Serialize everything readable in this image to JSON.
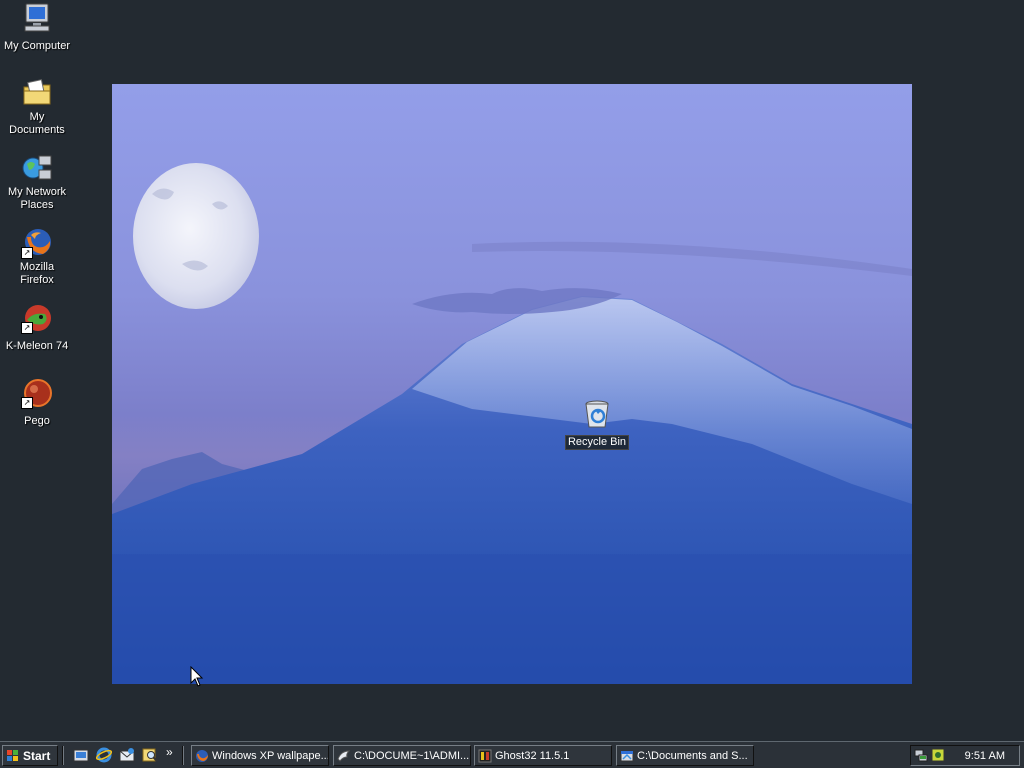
{
  "desktop_icons": [
    {
      "label": "My Computer",
      "icon": "computer-icon"
    },
    {
      "label": "My Documents",
      "icon": "folder-documents-icon"
    },
    {
      "label": "My Network Places",
      "icon": "network-places-icon"
    },
    {
      "label": "Mozilla Firefox",
      "icon": "firefox-icon"
    },
    {
      "label": "K-Meleon 74",
      "icon": "kmeleon-icon"
    },
    {
      "label": "Pego",
      "icon": "pego-icon"
    }
  ],
  "recycle_bin": {
    "label": "Recycle Bin",
    "icon": "recycle-bin-icon"
  },
  "taskbar": {
    "start_label": "Start",
    "more_label": "»",
    "quick_launch": [
      "show-desktop-icon",
      "internet-explorer-icon",
      "outlook-express-icon",
      "search-icon"
    ],
    "tasks": [
      {
        "label": "Windows XP wallpape...",
        "icon": "firefox-icon"
      },
      {
        "label": "C:\\DOCUME~1\\ADMI...",
        "icon": "bird-icon"
      },
      {
        "label": "Ghost32 11.5.1",
        "icon": "ghost-icon"
      },
      {
        "label": "C:\\Documents and S...",
        "icon": "explorer-window-icon"
      }
    ],
    "tray_icons": [
      "network-tray-icon",
      "utility-tray-icon"
    ],
    "clock": "9:51 AM"
  },
  "colors": {
    "desktop_background": "#232a31",
    "taskbar_background": "#2b3138",
    "sky_top": "#8f9ae6",
    "mountain_blue": "#2c55b0"
  }
}
